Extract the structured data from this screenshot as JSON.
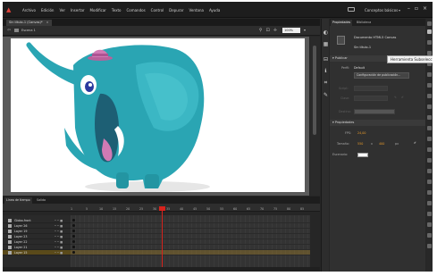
{
  "menubar": {
    "items": [
      "Archivo",
      "Edición",
      "Ver",
      "Insertar",
      "Modificar",
      "Texto",
      "Comandos",
      "Control",
      "Depurar",
      "Ventana",
      "Ayuda"
    ],
    "workspace_label": "Conceptos básicos"
  },
  "document": {
    "tab_label": "Sin título-1 (Canvas)*",
    "scene_label": "Escena 1",
    "zoom": "100%"
  },
  "properties": {
    "tabs": [
      "Propiedades",
      "Biblioteca"
    ],
    "doc_type": "Documento HTML5 Canvas",
    "doc_name": "Sin título-1",
    "tooltip": "Herramienta Subselección (A)",
    "publish_section": "Publicar",
    "profile_label": "Perfil:",
    "profile_value": "Default",
    "publish_settings_button": "Configuración de publicación...",
    "script_label": "Script:",
    "class_label": "Clase:",
    "target_label": "Destino:",
    "properties_section": "Propiedades",
    "fps_label": "FPS:",
    "fps_value": "24,00",
    "size_label": "Tamaño:",
    "width_value": "550",
    "x_sep": "x",
    "height_value": "400",
    "unit": "px",
    "stage_label": "Escenario:"
  },
  "timeline": {
    "tabs": [
      "Línea de tiempo",
      "Salida"
    ],
    "frame_numbers": [
      "1",
      "5",
      "10",
      "15",
      "20",
      "25",
      "30",
      "35",
      "40",
      "45",
      "50",
      "55",
      "60",
      "65",
      "70",
      "75",
      "80",
      "85"
    ],
    "layers": [
      "Globo-front",
      "Layer 26",
      "Layer 19",
      "Layer 23",
      "Layer 22",
      "Layer 21",
      "Layer 15"
    ],
    "selected_layer_index": 6
  },
  "colors": {
    "accent_playhead": "#d8231d",
    "elephant": "#2aa5b3",
    "hat": "#d07ab4",
    "stage_bg": "#ffffff"
  }
}
